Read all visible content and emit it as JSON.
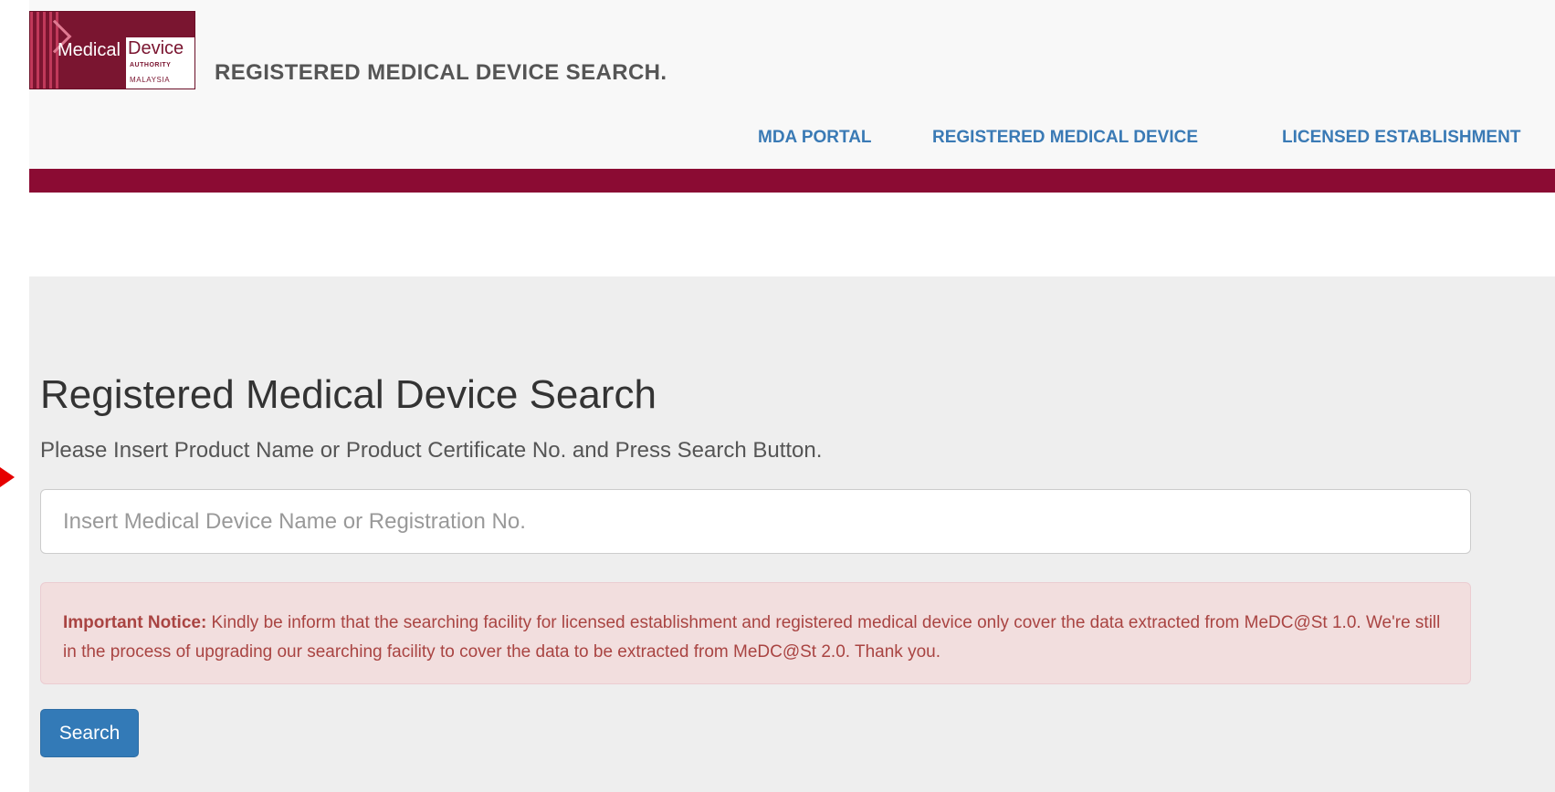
{
  "header": {
    "logo": {
      "word1": "Medical",
      "word2": "Device",
      "word3": "AUTHORITY",
      "word4": "MALAYSIA"
    },
    "site_title": "REGISTERED MEDICAL DEVICE SEARCH.",
    "nav": [
      {
        "label": "MDA PORTAL"
      },
      {
        "label": "REGISTERED MEDICAL DEVICE"
      },
      {
        "label": "LICENSED ESTABLISHMENT"
      }
    ]
  },
  "main": {
    "title": "Registered Medical Device Search",
    "subtitle": "Please Insert Product Name or Product Certificate No. and Press Search Button.",
    "search": {
      "value": "",
      "placeholder": "Insert Medical Device Name or Registration No."
    },
    "notice": {
      "label": "Important Notice:",
      "text": " Kindly be inform that the searching facility for licensed establishment and registered medical device only cover the data extracted from MeDC@St 1.0. We're still in the process of upgrading our searching facility to cover the data to be extracted from MeDC@St 2.0. Thank you."
    },
    "search_button": "Search"
  },
  "colors": {
    "brand_maroon": "#8b0b33",
    "nav_link": "#3a7ab5",
    "button_primary": "#337ab7",
    "notice_bg": "#f2dede",
    "notice_text": "#a94442",
    "pointer_arrow": "#e60000"
  },
  "icons": {
    "pointer": "red-arrow-icon"
  }
}
